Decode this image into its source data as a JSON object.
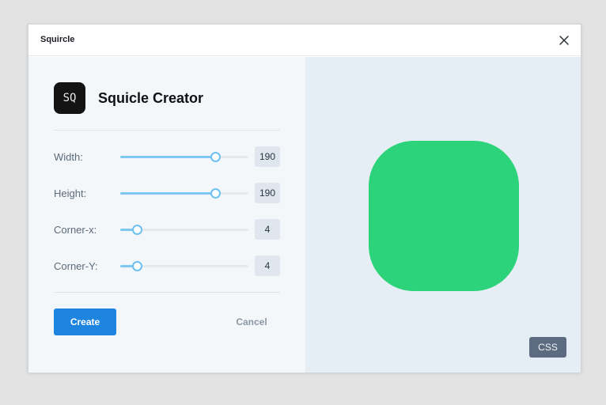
{
  "window": {
    "title": "Squircle"
  },
  "app": {
    "icon_text": "SQ",
    "name": "Squicle Creator"
  },
  "controls": [
    {
      "label": "Width:",
      "value": "190",
      "fraction": 0.74
    },
    {
      "label": "Height:",
      "value": "190",
      "fraction": 0.74
    },
    {
      "label": "Corner-x:",
      "value": "4",
      "fraction": 0.13
    },
    {
      "label": "Corner-Y:",
      "value": "4",
      "fraction": 0.13
    }
  ],
  "actions": {
    "create_label": "Create",
    "cancel_label": "Cancel"
  },
  "preview": {
    "color": "#2dd37a",
    "css_label": "CSS"
  },
  "colors": {
    "accent": "#1d84e0",
    "slider": "#7fc8f4"
  },
  "icons": {
    "close": "close-icon"
  }
}
